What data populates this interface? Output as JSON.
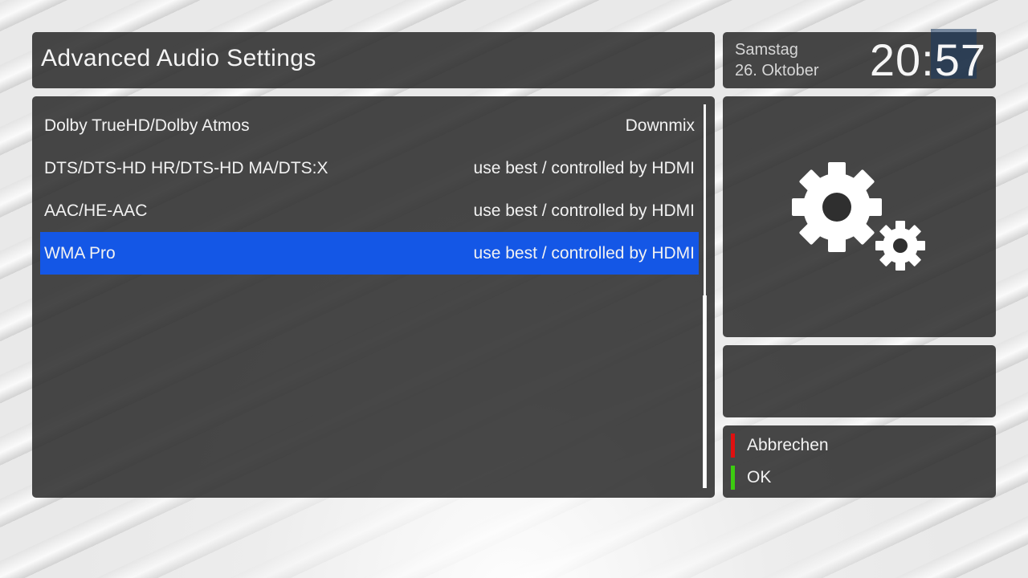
{
  "header": {
    "title": "Advanced Audio Settings"
  },
  "clock": {
    "weekday": "Samstag",
    "date": "26. Oktober",
    "time": "20:57"
  },
  "settings": [
    {
      "label": "Dolby TrueHD/Dolby Atmos",
      "value": "Downmix",
      "selected": false
    },
    {
      "label": "DTS/DTS-HD HR/DTS-HD MA/DTS:X",
      "value": "use best / controlled by HDMI",
      "selected": false
    },
    {
      "label": "AAC/HE-AAC",
      "value": "use best / controlled by HDMI",
      "selected": false
    },
    {
      "label": "WMA Pro",
      "value": "use best / controlled by HDMI",
      "selected": true
    }
  ],
  "icon": {
    "name": "gears-icon"
  },
  "buttons": {
    "cancel": {
      "label": "Abbrechen",
      "color": "#e01010"
    },
    "ok": {
      "label": "OK",
      "color": "#3ccc10"
    }
  },
  "colors": {
    "selection": "#1457e6",
    "panel": "#2a2a2a"
  }
}
